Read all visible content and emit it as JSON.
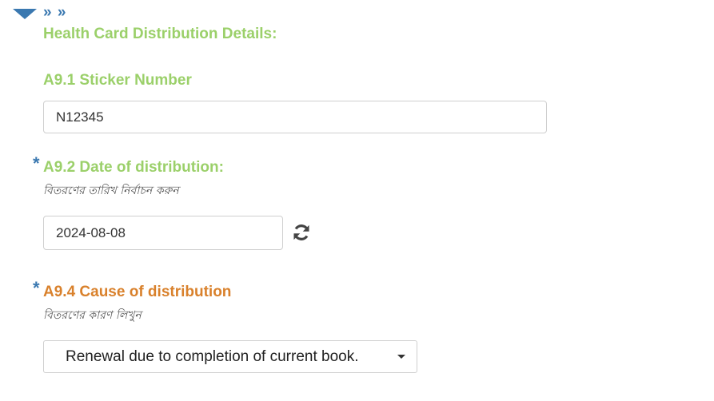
{
  "header": {
    "nav_chevrons": "» »",
    "section_title": "Health Card Distribution Details:"
  },
  "q_a9_1": {
    "label": "A9.1 Sticker Number",
    "value": "N12345"
  },
  "q_a9_2": {
    "required_marker": "*",
    "label": "A9.2 Date of distribution:",
    "hint": "বিতরণের তারিখ নির্বাচন করুন",
    "value": "2024-08-08",
    "refresh_icon": "refresh-icon"
  },
  "q_a9_4": {
    "required_marker": "*",
    "label": "A9.4 Cause of distribution",
    "hint": "বিতরণের কারণ লিখুন",
    "selected_value": "Renewal due to completion of current book."
  },
  "colors": {
    "accent_blue": "#3a78b0",
    "label_green": "#9bd06a",
    "label_orange": "#d9812c"
  }
}
